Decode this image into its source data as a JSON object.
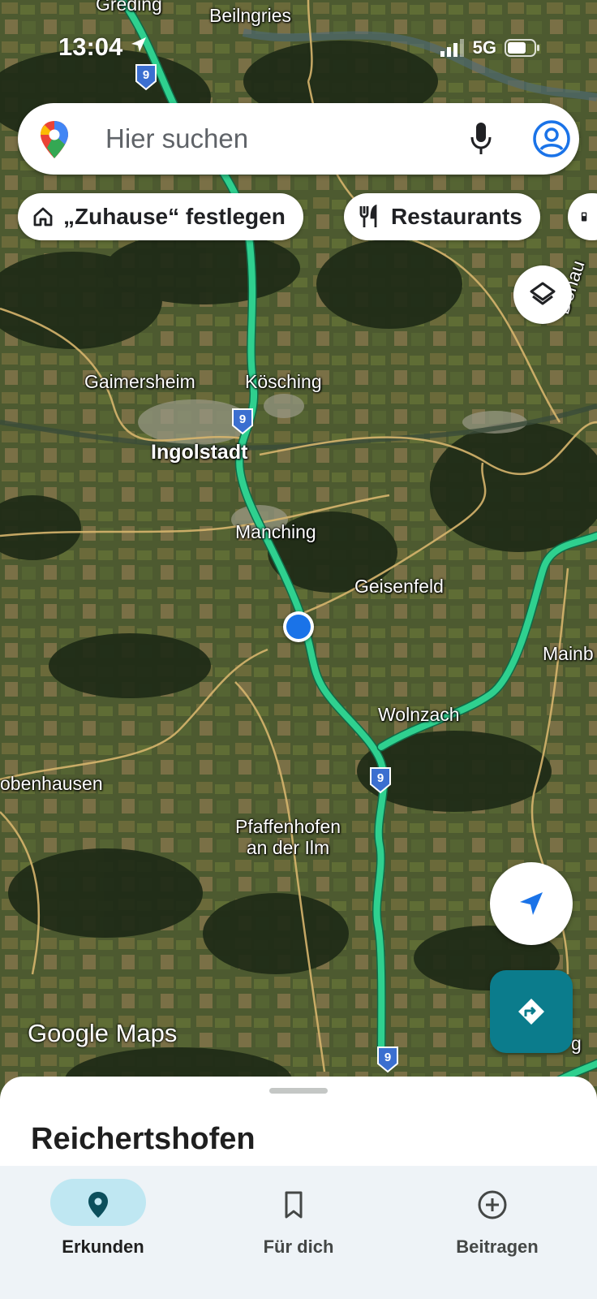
{
  "status_bar": {
    "time": "13:04",
    "network": "5G"
  },
  "search": {
    "placeholder": "Hier suchen"
  },
  "chips": {
    "home": "„Zuhause“ festlegen",
    "restaurants": "Restaurants"
  },
  "map": {
    "labels": {
      "greding": "Greding",
      "beilngries": "Beilngries",
      "gaimersheim": "Gaimersheim",
      "koesching": "Kösching",
      "ingolstadt": "Ingolstadt",
      "manching": "Manching",
      "geisenfeld": "Geisenfeld",
      "mainburg": "Mainb",
      "wolnzach": "Wolnzach",
      "schrobenhausen": "obenhausen",
      "pfaffenhofen_line1": "Pfaffenhofen",
      "pfaffenhofen_line2": "an der Ilm",
      "donau": "Donau",
      "edge_g": "g"
    },
    "highway_number": "9",
    "route_color": "#2fd08f",
    "location_color": "#1a73e8"
  },
  "logo": "Google Maps",
  "sheet": {
    "title": "Reichertshofen"
  },
  "nav": {
    "explore": "Erkunden",
    "for_you": "Für dich",
    "contribute": "Beitragen"
  }
}
